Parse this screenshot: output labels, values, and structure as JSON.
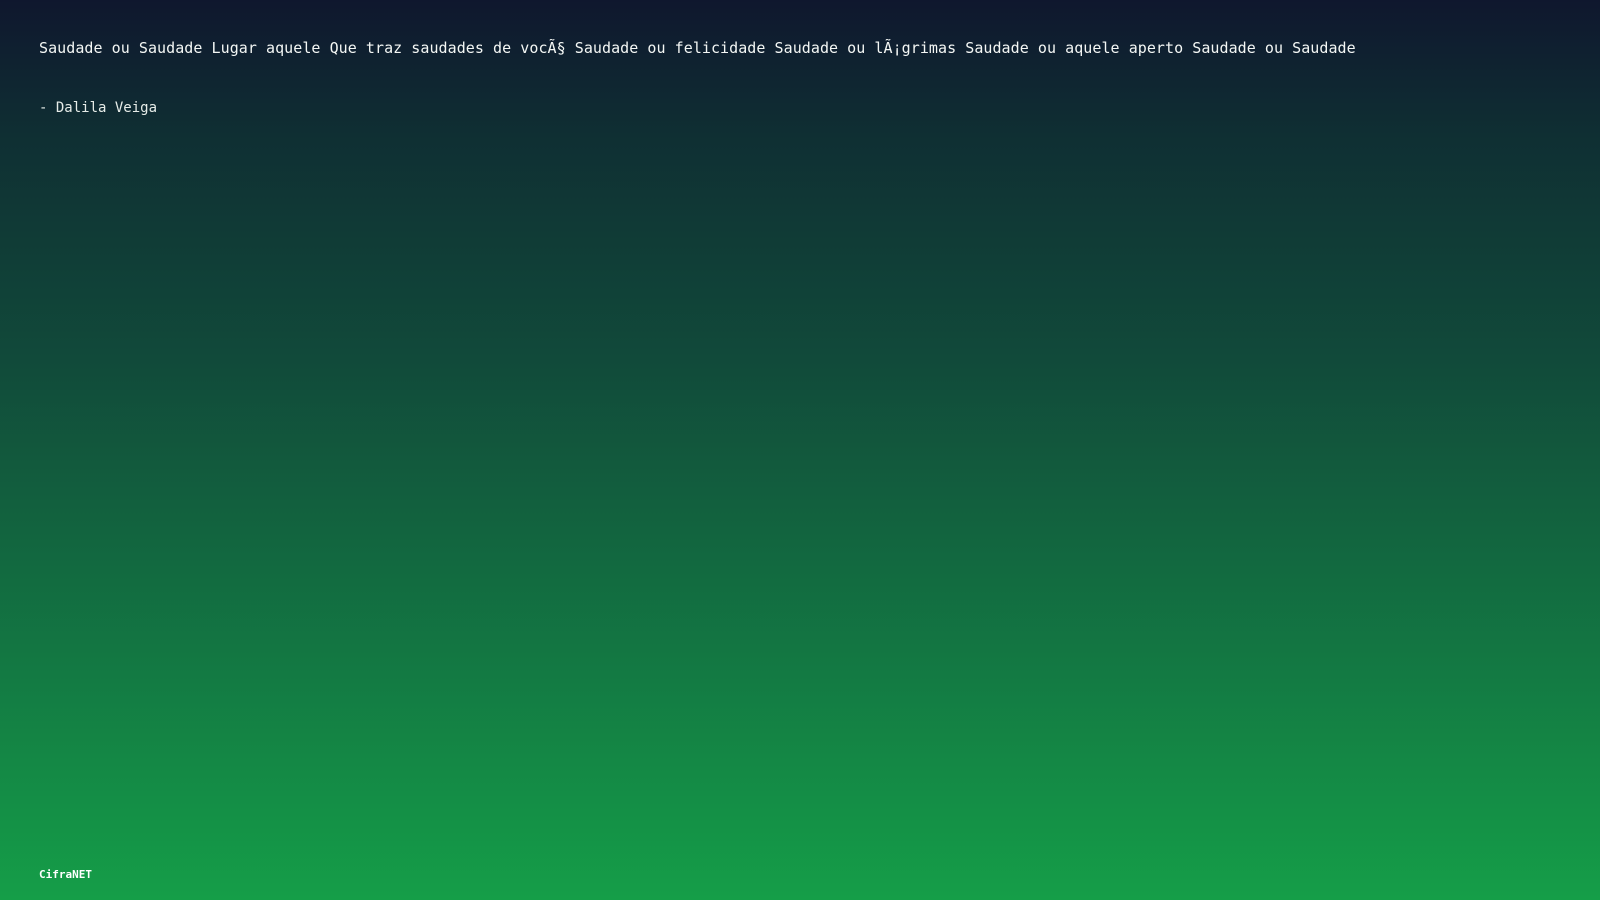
{
  "quote": {
    "text": "Saudade ou Saudade Lugar aquele Que traz saudades de vocÃ§ Saudade ou felicidade Saudade ou lÃ¡grimas Saudade ou aquele aperto Saudade ou Saudade",
    "author": "- Dalila Veiga"
  },
  "footer": {
    "brand": "CifraNET"
  },
  "colors": {
    "background_top": "#0f172e",
    "background_bottom": "#159e48",
    "text": "#ffffff"
  }
}
